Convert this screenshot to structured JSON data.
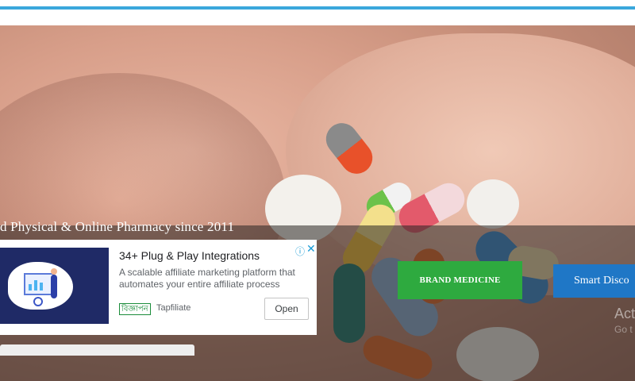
{
  "hero": {
    "tagline": "d Physical & Online Pharmacy since 2011"
  },
  "ad": {
    "title": "34+ Plug & Play Integrations",
    "description": "A scalable affiliate marketing platform that automates your entire affiliate process",
    "badge": "বিজ্ঞাপন",
    "advertiser": "Tapfiliate",
    "open_label": "Open",
    "adchoices_icon": "info-icon",
    "close_icon": "close-icon"
  },
  "buttons": {
    "brand_medicine": "BRAND MEDICINE",
    "smart_discount": "Smart Disco"
  },
  "watermark": {
    "line1": "Act",
    "line2": "Go t"
  },
  "colors": {
    "accent": "#3aa7dc",
    "brand_green": "#2eaa3f",
    "smart_blue": "#1f77c6"
  }
}
